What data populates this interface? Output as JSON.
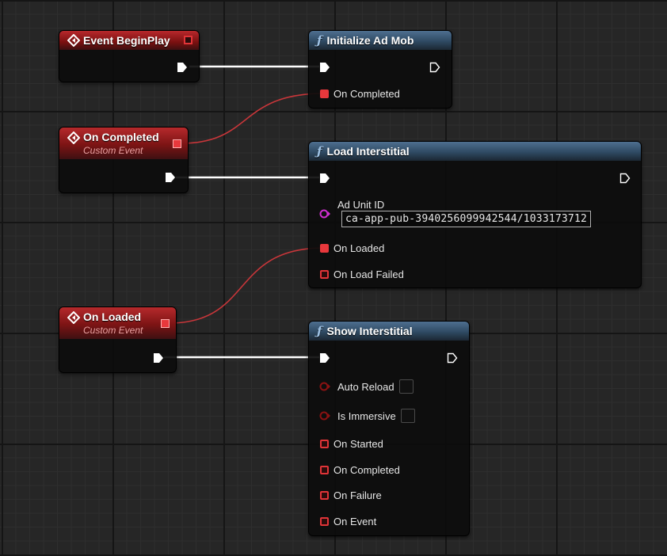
{
  "colors": {
    "exec_wire": "#ffffff",
    "delegate_wire": "#d0383b",
    "event_header": "#a01a1e",
    "function_header": "#3f5d7b",
    "string_pin": "#d12fd1",
    "bool_pin": "#8a1212"
  },
  "icons": {
    "event": "diamond-event-icon",
    "function": "function-f-icon",
    "exec": "exec-arrow-icon",
    "delegate": "delegate-square-icon"
  },
  "nodes": {
    "event_begin_play": {
      "title": "Event BeginPlay"
    },
    "on_completed_event": {
      "title": "On Completed",
      "subtitle": "Custom Event"
    },
    "on_loaded_event": {
      "title": "On Loaded",
      "subtitle": "Custom Event"
    },
    "initialize_ad_mob": {
      "title": "Initialize Ad Mob",
      "pins": {
        "on_completed": "On Completed"
      }
    },
    "load_interstitial": {
      "title": "Load Interstitial",
      "pins": {
        "ad_unit_id_label": "Ad Unit ID",
        "ad_unit_id_value": "ca-app-pub-3940256099942544/1033173712",
        "on_loaded": "On Loaded",
        "on_load_failed": "On Load Failed"
      }
    },
    "show_interstitial": {
      "title": "Show Interstitial",
      "pins": {
        "auto_reload": "Auto Reload",
        "auto_reload_checked": false,
        "is_immersive": "Is Immersive",
        "is_immersive_checked": false,
        "on_started": "On Started",
        "on_completed": "On Completed",
        "on_failure": "On Failure",
        "on_event": "On Event"
      }
    }
  }
}
